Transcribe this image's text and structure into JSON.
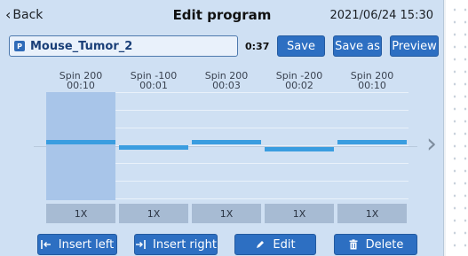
{
  "topbar": {
    "back_label": "Back",
    "title": "Edit program",
    "datetime": "2021/06/24 15:30"
  },
  "program": {
    "icon_letter": "P",
    "name": "Mouse_Tumor_2",
    "duration": "0:37"
  },
  "toolbar": {
    "save_label": "Save",
    "save_as_label": "Save as",
    "preview_label": "Preview"
  },
  "steps": [
    {
      "speed": "Spin 200",
      "time": "00:10",
      "repeat": "1X",
      "level": 0.2,
      "selected": true
    },
    {
      "speed": "Spin -100",
      "time": "00:01",
      "repeat": "1X",
      "level": -0.1,
      "selected": false
    },
    {
      "speed": "Spin 200",
      "time": "00:03",
      "repeat": "1X",
      "level": 0.2,
      "selected": false
    },
    {
      "speed": "Spin -200",
      "time": "00:02",
      "repeat": "1X",
      "level": -0.2,
      "selected": false
    },
    {
      "speed": "Spin 200",
      "time": "00:10",
      "repeat": "1X",
      "level": 0.2,
      "selected": false
    }
  ],
  "actions": {
    "insert_left_label": "Insert left",
    "insert_right_label": "Insert right",
    "edit_label": "Edit",
    "delete_label": "Delete"
  },
  "colors": {
    "accent": "#2d6fc2",
    "bar": "#3a9de0",
    "selected": "#a8c5e9",
    "background": "#cfe0f3"
  }
}
